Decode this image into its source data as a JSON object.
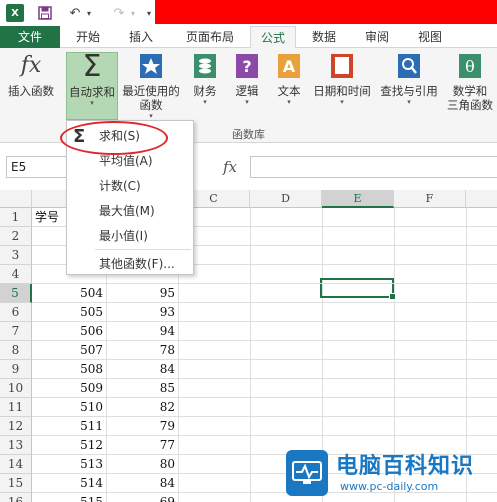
{
  "quick_access": {
    "app_icon": "X",
    "save_icon": "save-icon",
    "undo_icon": "undo-icon",
    "redo_icon": "redo-icon"
  },
  "tabs": [
    {
      "label": "文件"
    },
    {
      "label": "开始"
    },
    {
      "label": "插入"
    },
    {
      "label": "页面布局"
    },
    {
      "label": "公式",
      "active": true
    },
    {
      "label": "数据"
    },
    {
      "label": "审阅"
    },
    {
      "label": "视图"
    }
  ],
  "ribbon": {
    "insert_function": "插入函数",
    "autosum": "自动求和",
    "recent_line1": "最近使用的",
    "recent_line2": "函数",
    "financial": "财务",
    "logical": "逻辑",
    "text": "文本",
    "datetime": "日期和时间",
    "lookup": "查找与引用",
    "math_line1": "数学和",
    "math_line2": "三角函数",
    "group_label": "函数库"
  },
  "formula_bar": {
    "name_box": "E5",
    "fx": "fx",
    "value": ""
  },
  "columns": [
    "B",
    "C",
    "D",
    "E",
    "F"
  ],
  "selected_column": "E",
  "selected_row": 5,
  "rows": [
    {
      "n": "1",
      "a": "学号",
      "b": ""
    },
    {
      "n": "2",
      "a": "",
      "b": ""
    },
    {
      "n": "3",
      "a": "",
      "b": ""
    },
    {
      "n": "4",
      "a": "",
      "b": ""
    },
    {
      "n": "5",
      "a": "504",
      "b": "95"
    },
    {
      "n": "6",
      "a": "505",
      "b": "93"
    },
    {
      "n": "7",
      "a": "506",
      "b": "94"
    },
    {
      "n": "8",
      "a": "507",
      "b": "78"
    },
    {
      "n": "9",
      "a": "508",
      "b": "84"
    },
    {
      "n": "10",
      "a": "509",
      "b": "85"
    },
    {
      "n": "11",
      "a": "510",
      "b": "82"
    },
    {
      "n": "12",
      "a": "511",
      "b": "79"
    },
    {
      "n": "13",
      "a": "512",
      "b": "77"
    },
    {
      "n": "14",
      "a": "513",
      "b": "80"
    },
    {
      "n": "15",
      "a": "514",
      "b": "84"
    },
    {
      "n": "16",
      "a": "515",
      "b": "69"
    }
  ],
  "menu": {
    "sum": "求和(S)",
    "average": "平均值(A)",
    "count": "计数(C)",
    "max": "最大值(M)",
    "min": "最小值(I)",
    "more": "其他函数(F)..."
  },
  "watermark": {
    "title": "电脑百科知识",
    "url": "www.pc-daily.com"
  },
  "colors": {
    "excel_green": "#217346",
    "highlight_red": "#e0262a",
    "watermark_blue": "#1a78c2"
  }
}
